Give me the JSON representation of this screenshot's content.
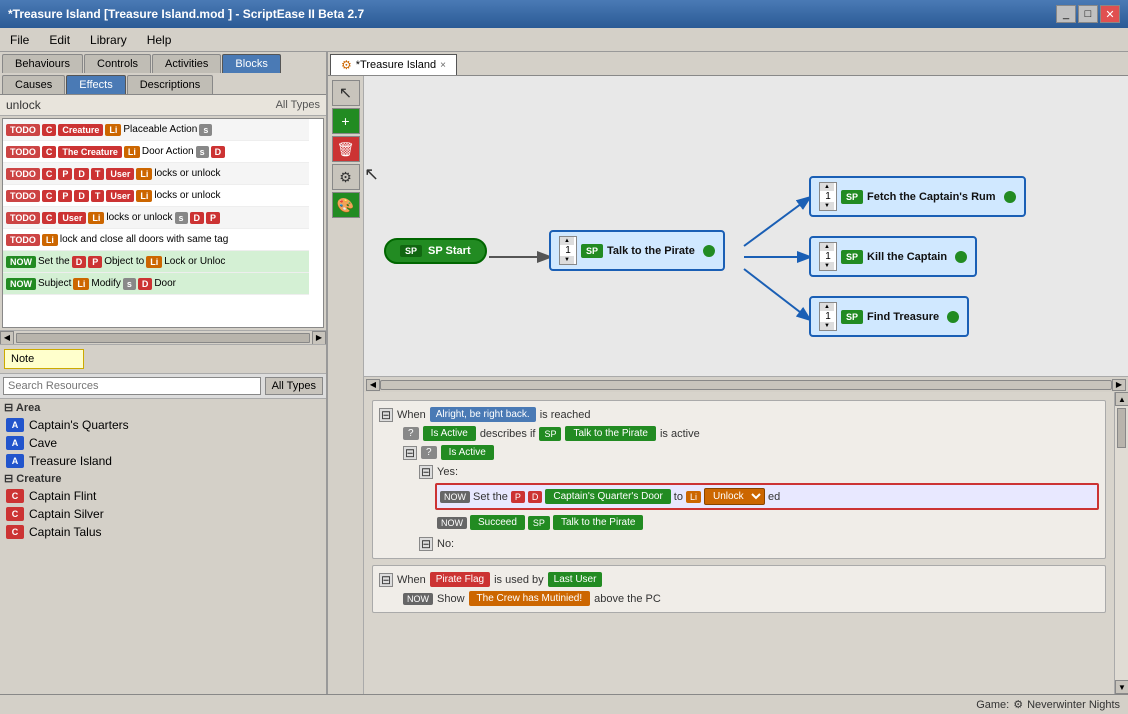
{
  "window": {
    "title": "*Treasure Island [Treasure Island.mod ] - ScriptEase II Beta 2.7",
    "tab_label": "*Treasure Island",
    "tab_close": "×"
  },
  "menu": {
    "items": [
      "File",
      "Edit",
      "Library",
      "Help"
    ]
  },
  "left_panel": {
    "tabs_row1": [
      "Behaviours",
      "Controls",
      "Activities",
      "Blocks"
    ],
    "tabs_row2": [
      "Causes",
      "Effects",
      "Descriptions"
    ],
    "active_tab_row1": "Blocks",
    "active_tab_row2": "Effects",
    "unlock_label": "unlock",
    "all_types_label": "All Types",
    "script_rows": [
      {
        "prefix": "TODO",
        "badges": [
          "C",
          "Creature"
        ],
        "text": "Li Placeable Action s"
      },
      {
        "prefix": "TODO",
        "badges": [
          "C",
          "The Creature"
        ],
        "text": "Li Door Action s D"
      },
      {
        "prefix": "TODO",
        "badges": [
          "C",
          "P",
          "D",
          "T",
          "User"
        ],
        "text": "Li locks or unlock"
      },
      {
        "prefix": "TODO",
        "badges": [
          "C",
          "P",
          "D",
          "T",
          "User"
        ],
        "text": "Li locks or unlock"
      },
      {
        "prefix": "TODO",
        "badges": [
          "C",
          "User"
        ],
        "text": "Li locks or unlock s D P"
      },
      {
        "prefix": "TODO",
        "badges": [
          "Li"
        ],
        "text": "lock and close all doors with same tag"
      },
      {
        "prefix": "NOW",
        "text": "Set the D P Object to Li Lock or Unloc"
      },
      {
        "prefix": "NOW",
        "text": "Subject Li Modify s D Door"
      }
    ],
    "note_label": "Note",
    "search_placeholder": "Search Resources",
    "resources_all_types": "All Types",
    "area_section": "Area",
    "area_items": [
      "Captain's Quarters",
      "Cave",
      "Treasure Island"
    ],
    "creature_section": "Creature",
    "creature_items": [
      "Captain Flint",
      "Captain Silver",
      "Captain Talus"
    ]
  },
  "graph": {
    "start_label": "SP Start",
    "node_talk": "Talk to the Pirate",
    "node_rum": "Fetch the Captain's Rum",
    "node_kill": "Kill the Captain",
    "node_find": "Find Treasure",
    "sp_label": "SP",
    "num_default": "1"
  },
  "script_area": {
    "when1": {
      "dl_text": "Alright, be right back.",
      "is_reached": "is reached",
      "describes_if": "describes if",
      "sp_text": "Talk to the Pirate",
      "is_active_text": "is active",
      "is_active_badge": "Is Active",
      "yes_label": "Yes:",
      "now_label": "NOW",
      "set_the": "Set the",
      "to_text": "to",
      "door_text": "Captain's Quarter's Door",
      "unlock_text": "Unlock",
      "ed_text": "ed",
      "succeed_label": "Succeed",
      "sp_talk": "Talk to the Pirate",
      "no_label": "No:"
    },
    "when2": {
      "p_text": "Pirate Flag",
      "is_used_by": "is used by",
      "c_text": "Last User",
      "now_label": "NOW",
      "show_text": "Show",
      "tx_text": "The Crew has Mutinied!",
      "above_pc": "above the PC"
    }
  },
  "status_bar": {
    "game_label": "Game:",
    "game_value": "Neverwinter Nights"
  },
  "icons": {
    "cursor": "↖",
    "add": "+",
    "delete": "🗑",
    "settings": "⚙",
    "paint": "🎨",
    "game_icon": "⚙"
  }
}
